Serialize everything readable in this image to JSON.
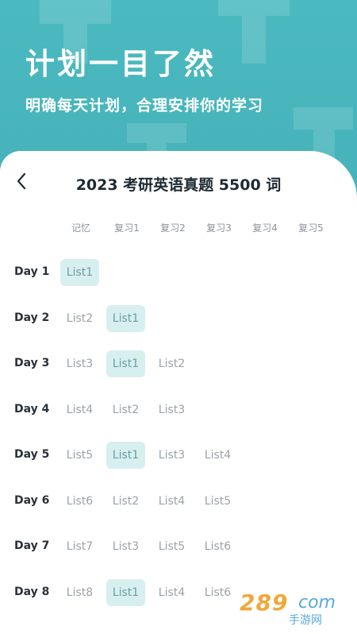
{
  "hero": {
    "headline": "计划一目了然",
    "subline": "明确每天计划，合理安排你的学习"
  },
  "header": {
    "title": "2023 考研英语真题 5500 词",
    "back_icon": "chevron-left-icon"
  },
  "columns": [
    "记忆",
    "复习1",
    "复习2",
    "复习3",
    "复习4",
    "复习5"
  ],
  "rows": [
    {
      "day": "Day 1",
      "cells": [
        "List1"
      ],
      "highlight": [
        0
      ]
    },
    {
      "day": "Day 2",
      "cells": [
        "List2",
        "List1"
      ],
      "highlight": [
        1
      ]
    },
    {
      "day": "Day 3",
      "cells": [
        "List3",
        "List1",
        "List2"
      ],
      "highlight": [
        1
      ]
    },
    {
      "day": "Day 4",
      "cells": [
        "List4",
        "List2",
        "List3"
      ],
      "highlight": []
    },
    {
      "day": "Day 5",
      "cells": [
        "List5",
        "List1",
        "List3",
        "List4"
      ],
      "highlight": [
        1
      ]
    },
    {
      "day": "Day 6",
      "cells": [
        "List6",
        "List2",
        "List4",
        "List5"
      ],
      "highlight": []
    },
    {
      "day": "Day 7",
      "cells": [
        "List7",
        "List3",
        "List5",
        "List6"
      ],
      "highlight": []
    },
    {
      "day": "Day 8",
      "cells": [
        "List8",
        "List1",
        "List4",
        "List6"
      ],
      "highlight": [
        1
      ]
    }
  ],
  "watermark": {
    "number": "289",
    "suffix": "com",
    "caption": "手游网"
  },
  "colors": {
    "hero": "#49b9bf",
    "highlight_bg": "#d8eff0",
    "highlight_text": "#6a9ea1"
  }
}
